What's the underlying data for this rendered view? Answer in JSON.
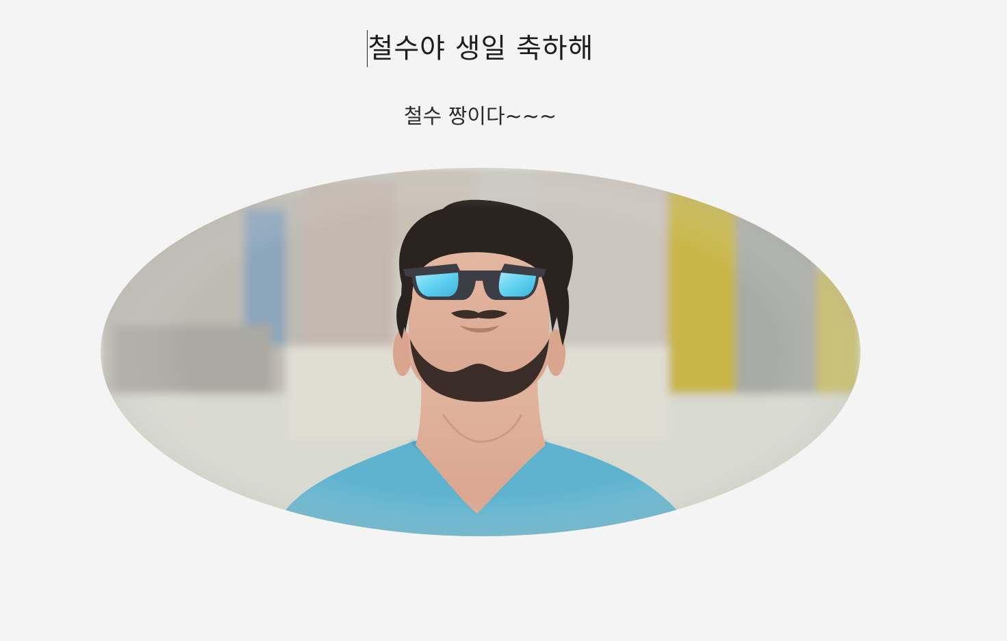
{
  "heading": {
    "title": "철수야 생일 축하해",
    "subtitle": "철수 짱이다~~~"
  },
  "photo": {
    "subject": "portrait-man-sunglasses",
    "colors": {
      "shirt": "#5fb3cf",
      "lens": "#67d4f0",
      "background_wall": "#cfd1c9",
      "yellow_pillar": "#c9b84c",
      "page_background": "#f4f4f4"
    }
  }
}
